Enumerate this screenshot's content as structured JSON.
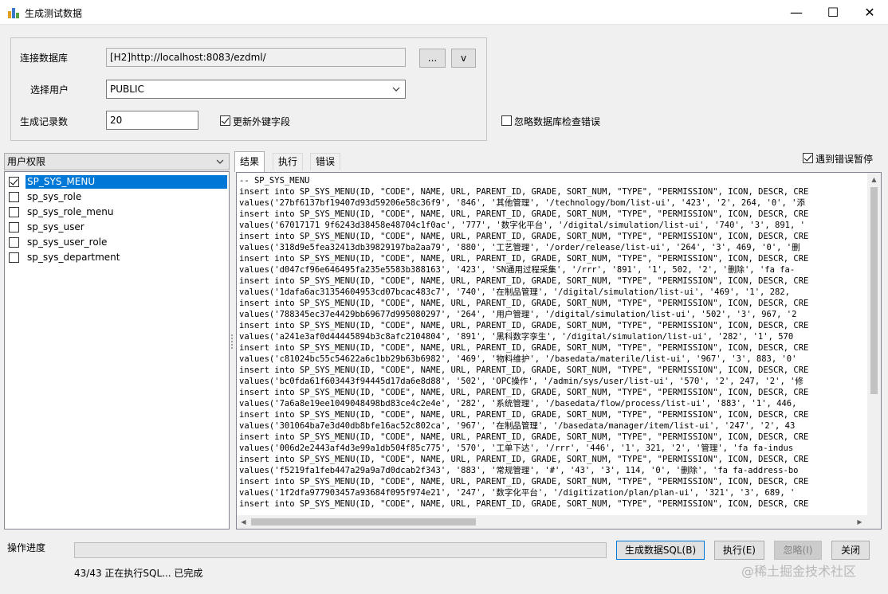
{
  "window": {
    "title": "生成测试数据",
    "minimize": "—",
    "maximize": "☐",
    "close": "✕"
  },
  "form": {
    "db_label": "连接数据库",
    "db_value": "[H2]http://localhost:8083/ezdml/",
    "db_browse": "...",
    "db_more": "v",
    "user_label": "选择用户",
    "user_value": "PUBLIC",
    "count_label": "生成记录数",
    "count_value": "20",
    "update_fk_label": "更新外键字段",
    "update_fk_checked": true,
    "ignore_check_label": "忽略数据库检查错误",
    "ignore_check_checked": false
  },
  "left": {
    "category": "用户权限",
    "items": [
      {
        "label": "SP_SYS_MENU",
        "checked": true,
        "selected": true
      },
      {
        "label": "sp_sys_role",
        "checked": false,
        "selected": false
      },
      {
        "label": "sp_sys_role_menu",
        "checked": false,
        "selected": false
      },
      {
        "label": "sp_sys_user",
        "checked": false,
        "selected": false
      },
      {
        "label": "sp_sys_user_role",
        "checked": false,
        "selected": false
      },
      {
        "label": "sp_sys_department",
        "checked": false,
        "selected": false
      }
    ]
  },
  "tabs": [
    {
      "label": "结果",
      "active": true
    },
    {
      "label": "执行",
      "active": false
    },
    {
      "label": "错误",
      "active": false
    }
  ],
  "pause_on_error_label": "遇到错误暂停",
  "pause_on_error_checked": true,
  "result_lines": [
    "-- SP_SYS_MENU",
    "insert into SP_SYS_MENU(ID, \"CODE\", NAME, URL, PARENT_ID, GRADE, SORT_NUM, \"TYPE\", \"PERMISSION\", ICON, DESCR, CRE",
    "values('27bf6137bf19407d93d59206e58c36f9', '846', '其他管理', '/technology/bom/list-ui', '423', '2', 264, '0', '添",
    "insert into SP_SYS_MENU(ID, \"CODE\", NAME, URL, PARENT_ID, GRADE, SORT_NUM, \"TYPE\", \"PERMISSION\", ICON, DESCR, CRE",
    "values('67017171 9f6243d38458e48704c1f0ac', '777', '数字化平台', '/digital/simulation/list-ui', '740', '3', 891, '",
    "insert into SP_SYS_MENU(ID, \"CODE\", NAME, URL, PARENT_ID, GRADE, SORT_NUM, \"TYPE\", \"PERMISSION\", ICON, DESCR, CRE",
    "values('318d9e5fea32413db39829197ba2aa79', '880', '工艺管理', '/order/release/list-ui', '264', '3', 469, '0', '删",
    "insert into SP_SYS_MENU(ID, \"CODE\", NAME, URL, PARENT_ID, GRADE, SORT_NUM, \"TYPE\", \"PERMISSION\", ICON, DESCR, CRE",
    "values('d047cf96e646495fa235e5583b388163', '423', 'SN通用过程采集', '/rrr', '891', '1', 502, '2', '删除', 'fa fa-",
    "insert into SP_SYS_MENU(ID, \"CODE\", NAME, URL, PARENT_ID, GRADE, SORT_NUM, \"TYPE\", \"PERMISSION\", ICON, DESCR, CRE",
    "values('1dafa6ac31354604953cd07bcac483c7', '740', '在制品管理', '/digital/simulation/list-ui', '469', '1', 282,",
    "insert into SP_SYS_MENU(ID, \"CODE\", NAME, URL, PARENT_ID, GRADE, SORT_NUM, \"TYPE\", \"PERMISSION\", ICON, DESCR, CRE",
    "values('788345ec37e4429bb69677d995080297', '264', '用户管理', '/digital/simulation/list-ui', '502', '3', 967, '2",
    "insert into SP_SYS_MENU(ID, \"CODE\", NAME, URL, PARENT_ID, GRADE, SORT_NUM, \"TYPE\", \"PERMISSION\", ICON, DESCR, CRE",
    "values('a241e3af0d44445894b3c8afc2104804', '891', '黑科数字孪生', '/digital/simulation/list-ui', '282', '1', 570",
    "insert into SP_SYS_MENU(ID, \"CODE\", NAME, URL, PARENT_ID, GRADE, SORT_NUM, \"TYPE\", \"PERMISSION\", ICON, DESCR, CRE",
    "values('c81024bc55c54622a6c1bb29b63b6982', '469', '物料维护', '/basedata/materile/list-ui', '967', '3', 883, '0'",
    "insert into SP_SYS_MENU(ID, \"CODE\", NAME, URL, PARENT_ID, GRADE, SORT_NUM, \"TYPE\", \"PERMISSION\", ICON, DESCR, CRE",
    "values('bc0fda61f603443f94445d17da6e8d88', '502', 'OPC操作', '/admin/sys/user/list-ui', '570', '2', 247, '2', '修",
    "insert into SP_SYS_MENU(ID, \"CODE\", NAME, URL, PARENT_ID, GRADE, SORT_NUM, \"TYPE\", \"PERMISSION\", ICON, DESCR, CRE",
    "values('7a6a8e19ee1049048498bd83ce4c2e4e', '282', '系统管理', '/basedata/flow/process/list-ui', '883', '1', 446,",
    "insert into SP_SYS_MENU(ID, \"CODE\", NAME, URL, PARENT_ID, GRADE, SORT_NUM, \"TYPE\", \"PERMISSION\", ICON, DESCR, CRE",
    "values('301064ba7e3d40db8bfe16ac52c802ca', '967', '在制品管理', '/basedata/manager/item/list-ui', '247', '2', 43",
    "insert into SP_SYS_MENU(ID, \"CODE\", NAME, URL, PARENT_ID, GRADE, SORT_NUM, \"TYPE\", \"PERMISSION\", ICON, DESCR, CRE",
    "values('006d2e2443af4d3e99a1db504f85c775', '570', '工单下达', '/rrr', '446', '1', 321, '2', '管理', 'fa fa-indus",
    "insert into SP_SYS_MENU(ID, \"CODE\", NAME, URL, PARENT_ID, GRADE, SORT_NUM, \"TYPE\", \"PERMISSION\", ICON, DESCR, CRE",
    "values('f5219fa1feb447a29a9a7d0dcab2f343', '883', '常规管理', '#', '43', '3', 114, '0', '删除', 'fa fa-address-bo",
    "insert into SP_SYS_MENU(ID, \"CODE\", NAME, URL, PARENT_ID, GRADE, SORT_NUM, \"TYPE\", \"PERMISSION\", ICON, DESCR, CRE",
    "values('1f2dfa977903457a93684f095f974e21', '247', '数字化平台', '/digitization/plan/plan-ui', '321', '3', 689, '",
    "insert into SP_SYS_MENU(ID, \"CODE\", NAME, URL, PARENT_ID, GRADE, SORT_NUM, \"TYPE\", \"PERMISSION\", ICON, DESCR, CRE"
  ],
  "bottom": {
    "progress_label": "操作进度",
    "progress_value": 0,
    "status": "43/43 正在执行SQL... 已完成",
    "gen_sql": "生成数据SQL(B)",
    "execute": "执行(E)",
    "ignore": "忽略(I)",
    "close": "关闭"
  },
  "watermark": "@稀土掘金技术社区"
}
